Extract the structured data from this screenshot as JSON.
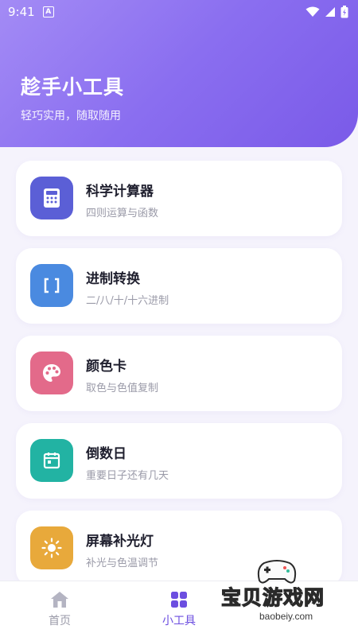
{
  "status_bar": {
    "time": "9:41",
    "app_indicator": "A",
    "icons": [
      "wifi-icon",
      "signal-icon",
      "battery-icon"
    ]
  },
  "header": {
    "title": "趁手小工具",
    "subtitle": "轻巧实用，随取随用",
    "gradient": [
      "#a38bf5",
      "#7a5ae8"
    ]
  },
  "tools": [
    {
      "title": "科学计算器",
      "subtitle": "四则运算与函数",
      "icon": "calculator-icon",
      "color": "#5b5fd6"
    },
    {
      "title": "进制转换",
      "subtitle": "二/八/十/十六进制",
      "icon": "brackets-icon",
      "color": "#4a8ae0"
    },
    {
      "title": "颜色卡",
      "subtitle": "取色与色值复制",
      "icon": "palette-icon",
      "color": "#e36a8a"
    },
    {
      "title": "倒数日",
      "subtitle": "重要日子还有几天",
      "icon": "calendar-icon",
      "color": "#22b3a3"
    },
    {
      "title": "屏幕补光灯",
      "subtitle": "补光与色温调节",
      "icon": "sun-icon",
      "color": "#e8a93b"
    }
  ],
  "bottom_nav": {
    "items": [
      {
        "label": "首页",
        "icon": "home-icon",
        "active": false
      },
      {
        "label": "小工具",
        "icon": "tools-grid-icon",
        "active": true
      }
    ],
    "accent": "#6c4ee0"
  },
  "watermark": {
    "text": "宝贝游戏网",
    "url": "baobeiy.com"
  }
}
